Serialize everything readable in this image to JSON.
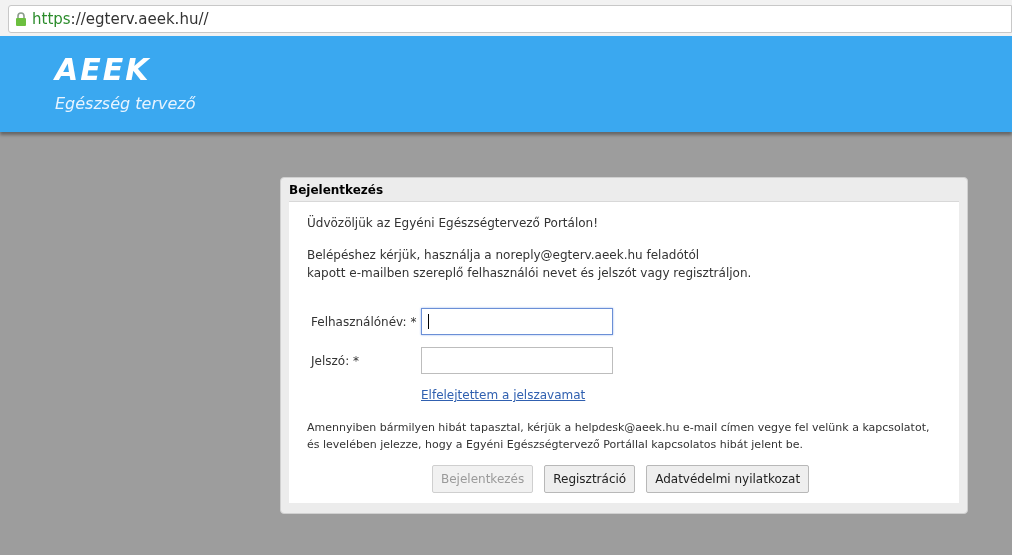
{
  "address_bar": {
    "scheme": "https",
    "rest": "://egterv.aeek.hu//"
  },
  "header": {
    "logo": "AEEK",
    "tagline": "Egészség tervező"
  },
  "login_dialog": {
    "title": "Bejelentkezés",
    "welcome": "Üdvözöljük az Egyéni Egészségtervező Portálon!",
    "instructions": [
      "Belépéshez kérjük, használja a noreply@egterv.aeek.hu feladótól",
      "kapott e-mailben szereplő felhasználói nevet és jelszót vagy regisztráljon."
    ],
    "fields": [
      {
        "label": "Felhasználónév: *",
        "focused": true
      },
      {
        "label": "Jelszó: *",
        "focused": false
      }
    ],
    "forgot_link": "Elfelejtettem a jelszavamat",
    "help_text": [
      "Amennyiben bármilyen hibát tapasztal, kérjük a helpdesk@aeek.hu e-mail címen vegye fel velünk a kapcsolatot,",
      "és levelében jelezze, hogy a Egyéni Egészségtervező Portállal kapcsolatos hibát jelent be."
    ],
    "buttons": [
      {
        "label": "Bejelentkezés",
        "disabled": true
      },
      {
        "label": "Regisztráció",
        "disabled": false
      },
      {
        "label": "Adatvédelmi nyilatkozat",
        "disabled": false
      }
    ]
  }
}
